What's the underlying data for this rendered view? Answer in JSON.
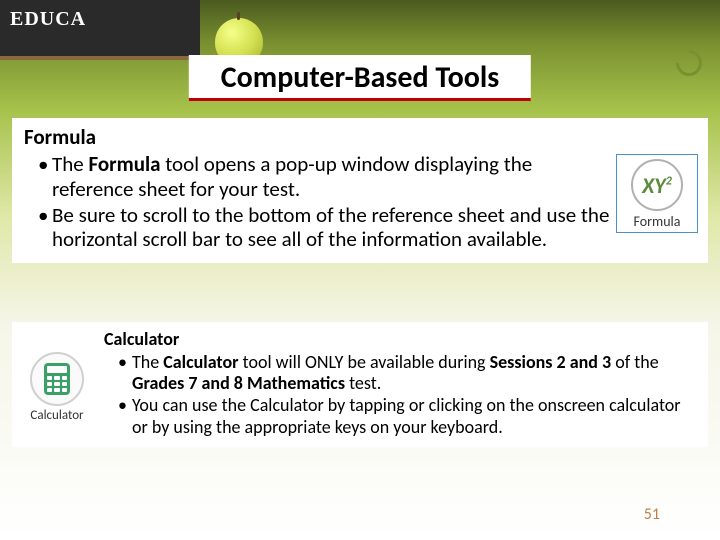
{
  "chalkboard": "EDUCA",
  "title": "Computer-Based Tools",
  "section1": {
    "heading": "Formula",
    "bullets": [
      {
        "pre": "The ",
        "strong": "Formula",
        "post": " tool opens a pop-up window displaying the reference sheet for your test."
      },
      {
        "text": "Be sure to scroll to the bottom of the reference sheet and use the horizontal scroll bar to see all of the information available."
      }
    ],
    "icon": {
      "xy": "XY",
      "sup": "2",
      "label": "Formula"
    }
  },
  "section2": {
    "heading": "Calculator",
    "bullets": [
      {
        "pre": "The ",
        "s1": "Calculator",
        "mid1": " tool will ONLY be available during ",
        "s2": "Sessions 2 and 3",
        "mid2": " of the ",
        "s3": "Grades 7 and 8 Mathematics",
        "post": " test."
      },
      {
        "text": "You can use the Calculator by tapping or clicking on the onscreen calculator or by using the appropriate keys on your keyboard."
      }
    ],
    "icon": {
      "label": "Calculator"
    }
  },
  "page_number": "51"
}
